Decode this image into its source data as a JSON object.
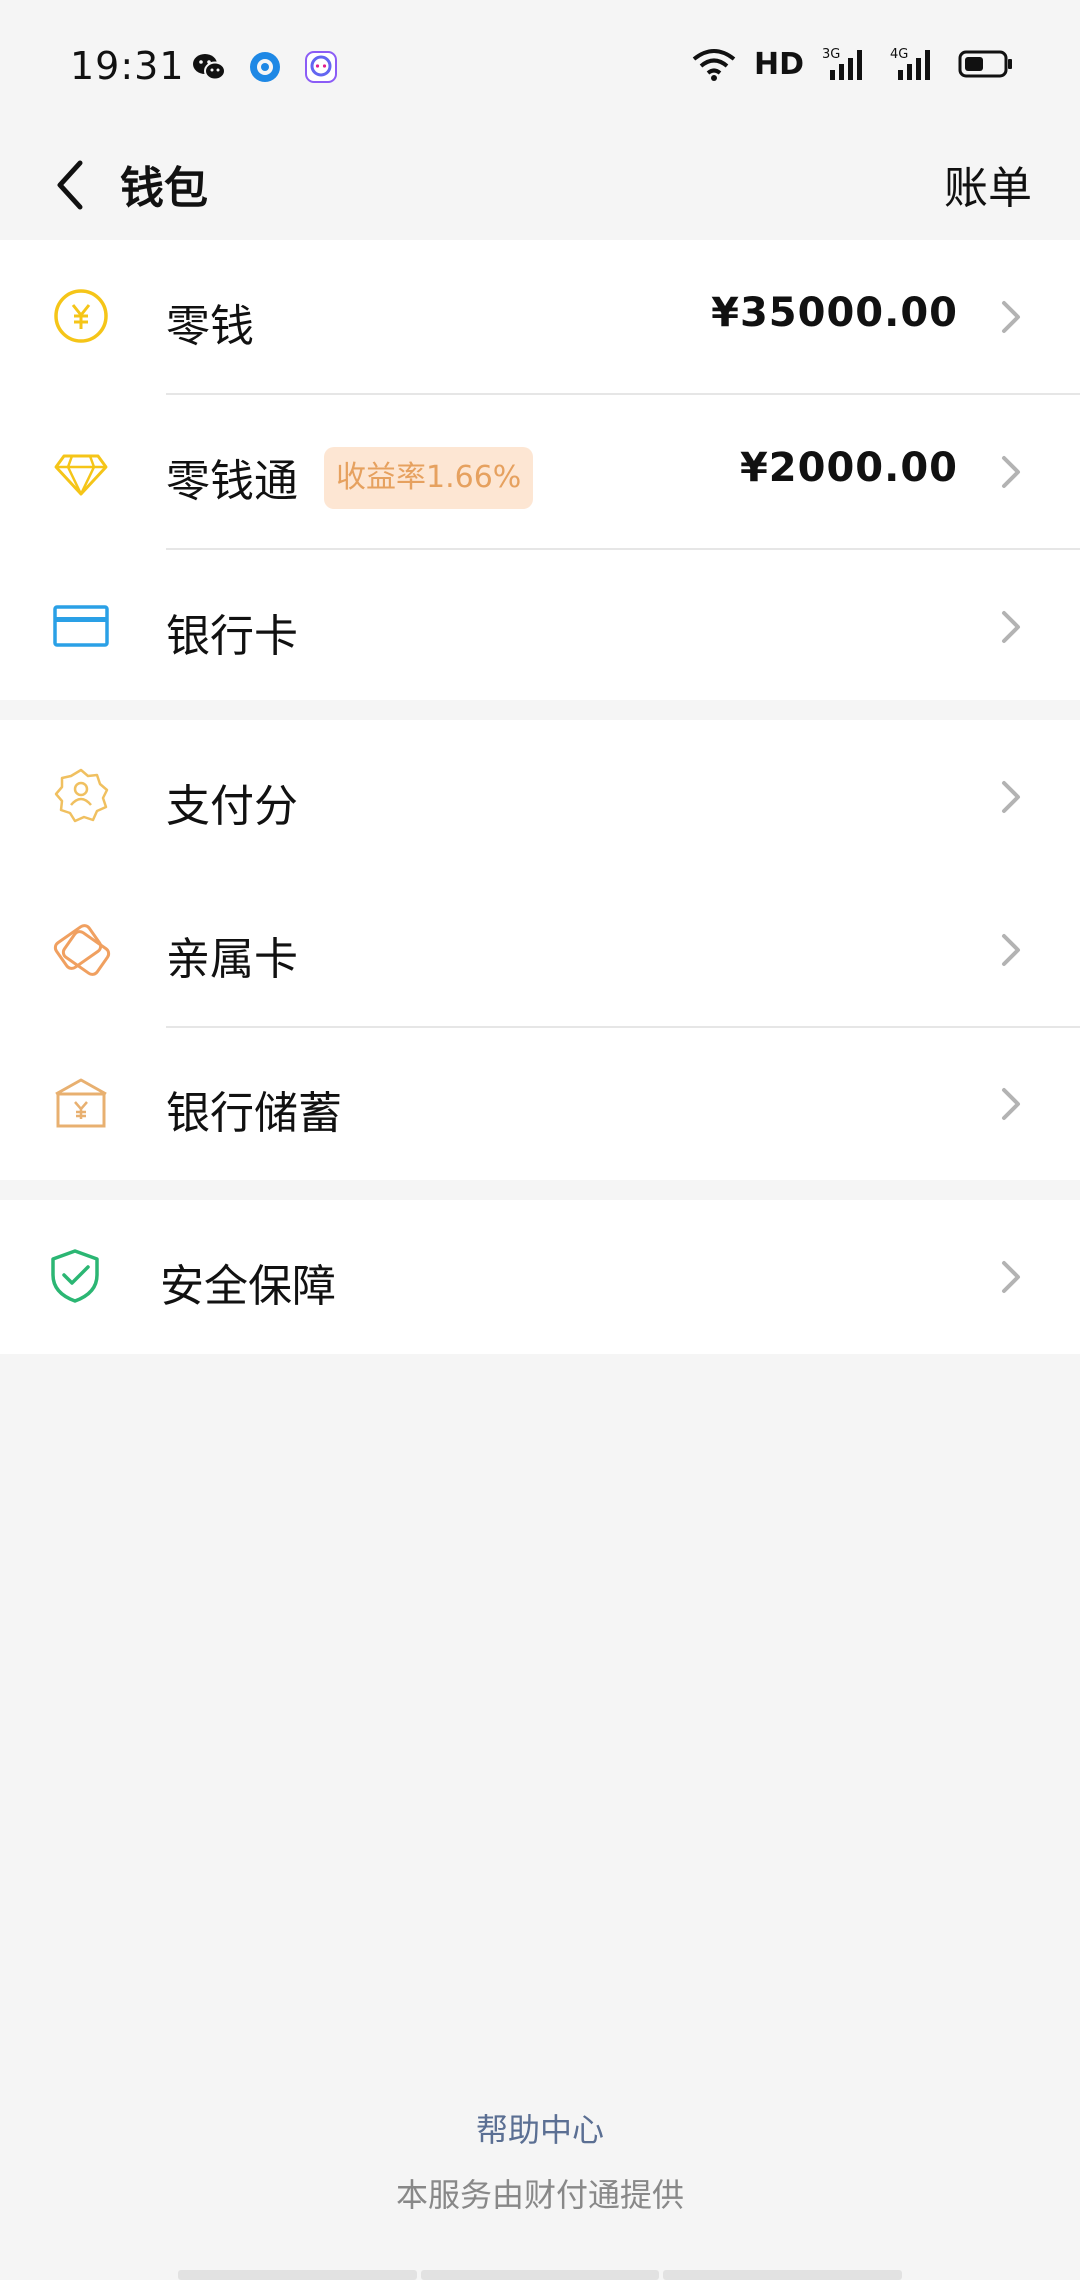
{
  "status_bar": {
    "time": "19:31",
    "network_hd": "HD",
    "signal_1_label": "3G",
    "signal_2_label": "4G",
    "icons": [
      "wechat-icon",
      "browser-icon",
      "chat-app-icon",
      "wifi-icon",
      "signal-3g-icon",
      "signal-4g-icon",
      "battery-icon"
    ]
  },
  "nav": {
    "title": "钱包",
    "bill": "账单",
    "back_icon": "chevron-left-icon"
  },
  "section1": {
    "rows": [
      {
        "label": "零钱",
        "amount": "¥35000.00",
        "icon": "yuan-coin-icon",
        "color": "#f5c518"
      },
      {
        "label": "零钱通",
        "badge": "收益率1.66%",
        "amount": "¥2000.00",
        "icon": "diamond-icon",
        "color": "#f5c518"
      },
      {
        "label": "银行卡",
        "icon": "bank-card-icon",
        "color": "#2aa0e6"
      }
    ]
  },
  "section2": {
    "rows": [
      {
        "label": "支付分",
        "icon": "pay-score-badge-icon",
        "color": "#f0c060"
      },
      {
        "label": "亲属卡",
        "icon": "family-card-icon",
        "color": "#f0a060"
      },
      {
        "label": "银行储蓄",
        "icon": "bank-savings-icon",
        "color": "#e8b070"
      }
    ]
  },
  "section3": {
    "rows": [
      {
        "label": "安全保障",
        "icon": "shield-check-icon",
        "color": "#2bb673"
      }
    ]
  },
  "footer": {
    "help": "帮助中心",
    "note": "本服务由财付通提供"
  },
  "colors": {
    "background": "#f5f5f5",
    "badge_bg": "#fde6d3",
    "badge_text": "#e6a15f",
    "link": "#5b6f93"
  }
}
